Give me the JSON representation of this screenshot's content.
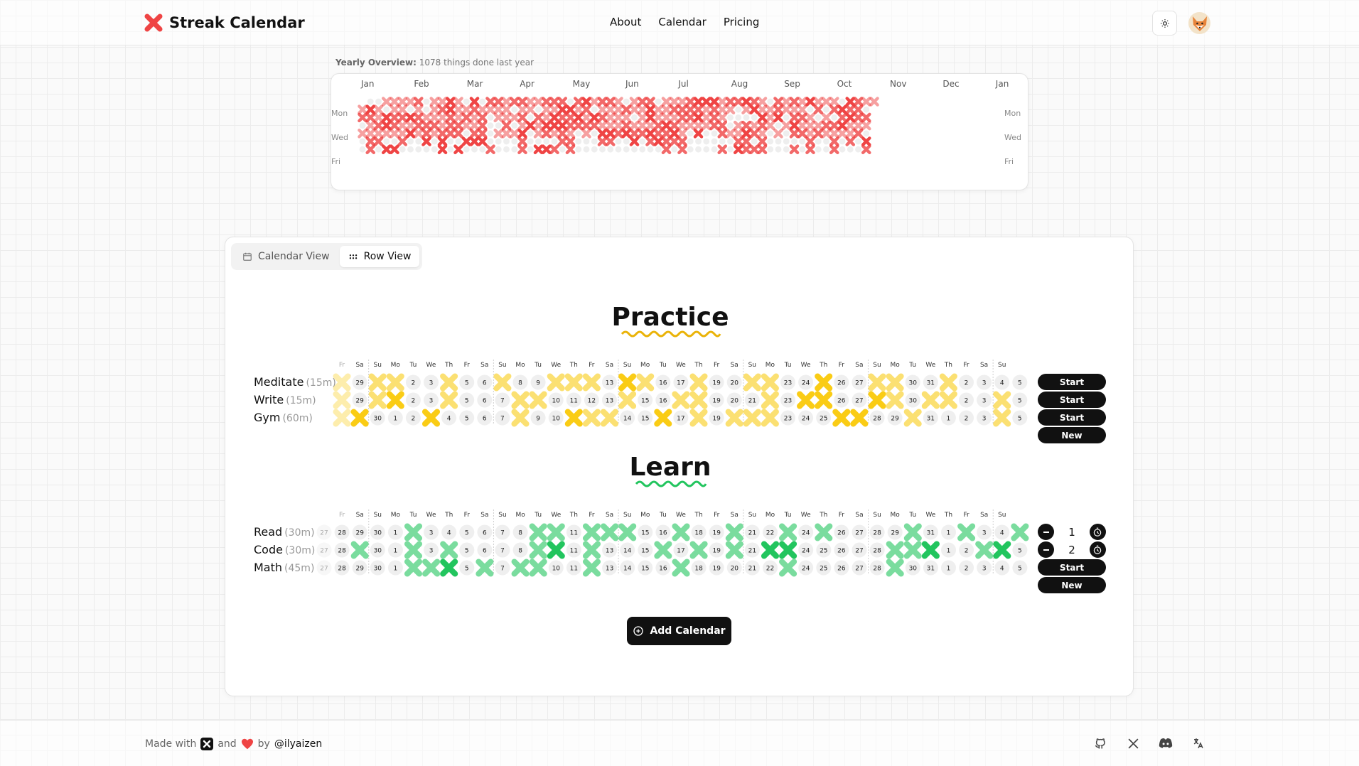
{
  "app": {
    "title": "Streak Calendar"
  },
  "nav": {
    "about": "About",
    "calendar": "Calendar",
    "pricing": "Pricing"
  },
  "icons": {
    "brand": "x-mark-icon",
    "theme": "sun-icon",
    "avatar": "fox-avatar",
    "calendar_view": "calendar-icon",
    "row_view": "grid-dots-icon",
    "add": "plus-circle-icon",
    "decrement": "minus-icon",
    "timer": "stopwatch-icon",
    "github": "github-icon",
    "x": "x-logo-icon",
    "discord": "discord-icon",
    "language": "translate-icon",
    "heart": "heart-icon"
  },
  "colors": {
    "brand": "#ef4444",
    "practice": "#facc15",
    "learn": "#22c55e"
  },
  "yearly": {
    "title_bold": "Yearly Overview:",
    "title_rest": "1078 things done last year",
    "months": [
      "Jan",
      "Feb",
      "Mar",
      "Apr",
      "May",
      "Jun",
      "Jul",
      "Aug",
      "Sep",
      "Oct",
      "Nov",
      "Dec",
      "Jan"
    ],
    "days_left": [
      "Mon",
      "Wed",
      "Fri"
    ],
    "days_right": [
      "Mon",
      "Wed",
      "Fri"
    ]
  },
  "views": {
    "calendar": "Calendar View",
    "row": "Row View"
  },
  "practice": {
    "title": "Practice",
    "weekdays": [
      "Fr",
      "Sa",
      "Su",
      "Mo",
      "Tu",
      "We",
      "Th",
      "Fr",
      "Sa",
      "Su",
      "Mo",
      "Tu",
      "We",
      "Th",
      "Fr",
      "Sa",
      "Su",
      "Mo",
      "Tu",
      "We",
      "Th",
      "Fr",
      "Sa",
      "Su",
      "Mo",
      "Tu",
      "We",
      "Th",
      "Fr",
      "Sa",
      "Su",
      "Mo",
      "Tu",
      "We",
      "Th",
      "Fr",
      "Sa",
      "Su"
    ],
    "days": [
      28,
      29,
      30,
      1,
      2,
      3,
      4,
      5,
      6,
      7,
      8,
      9,
      10,
      11,
      12,
      13,
      14,
      15,
      16,
      17,
      18,
      19,
      20,
      21,
      22,
      23,
      24,
      25,
      26,
      27,
      28,
      29,
      30,
      31,
      1,
      2,
      3,
      4,
      5
    ],
    "habits": [
      {
        "name": "Meditate",
        "duration": "(15m)",
        "action": "Start",
        "marks": [
          1,
          0,
          2,
          2,
          0,
          0,
          2,
          0,
          0,
          2,
          0,
          0,
          2,
          2,
          2,
          0,
          3,
          2,
          0,
          0,
          2,
          0,
          0,
          2,
          2,
          0,
          0,
          3,
          0,
          0,
          2,
          2,
          0,
          0,
          2,
          0,
          0,
          0,
          0
        ]
      },
      {
        "name": "Write",
        "duration": "(15m)",
        "action": "Start",
        "marks": [
          1,
          0,
          2,
          3,
          0,
          0,
          2,
          0,
          0,
          0,
          2,
          2,
          0,
          0,
          0,
          0,
          2,
          0,
          0,
          2,
          2,
          0,
          0,
          0,
          2,
          0,
          3,
          3,
          0,
          0,
          3,
          2,
          0,
          2,
          2,
          0,
          0,
          2,
          0
        ]
      },
      {
        "name": "Gym",
        "duration": "(60m)",
        "action": "Start",
        "marks": [
          1,
          3,
          0,
          0,
          0,
          3,
          0,
          0,
          0,
          0,
          2,
          0,
          0,
          3,
          2,
          2,
          0,
          0,
          3,
          0,
          2,
          0,
          2,
          2,
          2,
          0,
          0,
          0,
          3,
          3,
          0,
          0,
          2,
          0,
          0,
          0,
          0,
          2,
          0
        ]
      }
    ],
    "new_label": "New"
  },
  "learn": {
    "title": "Learn",
    "weekdays": [
      "Fr",
      "Sa",
      "Su",
      "Mo",
      "Tu",
      "We",
      "Th",
      "Fr",
      "Sa",
      "Su",
      "Mo",
      "Tu",
      "We",
      "Th",
      "Fr",
      "Sa",
      "Su",
      "Mo",
      "Tu",
      "We",
      "Th",
      "Fr",
      "Sa",
      "Su",
      "Mo",
      "Tu",
      "We",
      "Th",
      "Fr",
      "Sa",
      "Su",
      "Mo",
      "Tu",
      "We",
      "Th",
      "Fr",
      "Sa",
      "Su"
    ],
    "days": [
      27,
      28,
      29,
      30,
      1,
      2,
      3,
      4,
      5,
      6,
      7,
      8,
      9,
      10,
      11,
      12,
      13,
      14,
      15,
      16,
      17,
      18,
      19,
      20,
      21,
      22,
      23,
      24,
      25,
      26,
      27,
      28,
      29,
      30,
      31,
      1,
      2,
      3,
      4,
      5
    ],
    "habits": [
      {
        "name": "Read",
        "duration": "(30m)",
        "counter": "1",
        "marks": [
          0,
          0,
          0,
          0,
          2,
          0,
          0,
          0,
          0,
          0,
          0,
          2,
          2,
          0,
          2,
          2,
          2,
          0,
          0,
          2,
          0,
          0,
          2,
          0,
          0,
          2,
          0,
          2,
          0,
          0,
          0,
          0,
          2,
          0,
          0,
          2,
          0,
          0,
          2
        ]
      },
      {
        "name": "Code",
        "duration": "(30m)",
        "counter": "2",
        "marks": [
          0,
          2,
          0,
          0,
          2,
          0,
          2,
          0,
          0,
          0,
          0,
          2,
          3,
          0,
          2,
          0,
          0,
          0,
          2,
          0,
          2,
          0,
          2,
          0,
          3,
          3,
          0,
          0,
          0,
          0,
          0,
          2,
          2,
          3,
          0,
          0,
          2,
          3
        ]
      },
      {
        "name": "Math",
        "duration": "(45m)",
        "action": "Start",
        "marks": [
          0,
          0,
          0,
          0,
          2,
          2,
          3,
          0,
          2,
          0,
          2,
          2,
          0,
          0,
          2,
          0,
          0,
          0,
          0,
          2,
          0,
          0,
          0,
          0,
          0,
          2,
          0,
          0,
          0,
          0,
          0,
          2,
          0,
          0,
          0,
          0,
          0,
          0,
          0
        ]
      }
    ],
    "new_label": "New"
  },
  "add_calendar": "Add Calendar",
  "footer": {
    "made_with": "Made with",
    "and": "and",
    "by": "by",
    "handle": "@ilyaizen"
  }
}
